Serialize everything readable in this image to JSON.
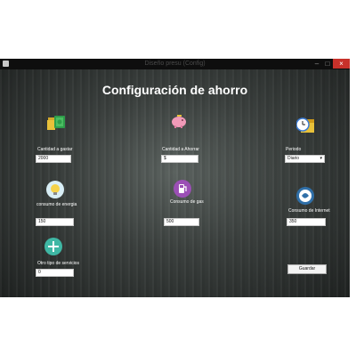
{
  "window": {
    "title": "Diseño presu (Config)"
  },
  "controls": {
    "minimize": "–",
    "maximize": "□",
    "close": "×"
  },
  "heading": "Configuración de ahorro",
  "fields": {
    "cantidad_gastar": {
      "label": "Cantidad a gastar",
      "value": "2000",
      "icon": "money-stack-icon"
    },
    "cantidad_ahorrar": {
      "label": "Cantidad a Ahorrar",
      "value": "$",
      "icon": "piggy-bank-icon"
    },
    "periodo": {
      "label": "Periodo",
      "value": "Diario",
      "icon": "calendar-clock-icon"
    },
    "consumo_energia": {
      "label": "consumo de energia",
      "value": "150",
      "icon": "light-bulb-icon"
    },
    "consumo_gas": {
      "label": "Consumo de gas",
      "value": "500",
      "icon": "gas-pump-icon"
    },
    "consumo_internet": {
      "label": "Consumo de Internet",
      "value": "350",
      "icon": "internet-globe-icon"
    },
    "otro_servicios": {
      "label": "Otro tipo de servicios",
      "value": "0",
      "icon": "plus-circle-icon"
    }
  },
  "save_button": "Guardar",
  "colors": {
    "close": "#c7312a",
    "heading": "#ffffff",
    "background": "#3b403e"
  }
}
